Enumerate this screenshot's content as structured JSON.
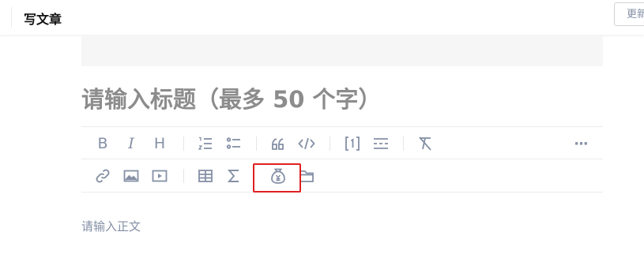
{
  "header": {
    "title": "写文章",
    "update_button": "更新"
  },
  "editor": {
    "title_placeholder": "请输入标题（最多 50 个字）",
    "body_placeholder": "请输入正文"
  },
  "toolbar": {
    "bold": "B",
    "italic": "I",
    "heading": "H",
    "more": "···",
    "icons": [
      "bold-icon",
      "italic-icon",
      "heading-icon",
      "ordered-list-icon",
      "unordered-list-icon",
      "quote-icon",
      "code-icon",
      "reference-icon",
      "divider-icon",
      "clear-format-icon",
      "more-icon",
      "link-icon",
      "image-icon",
      "video-icon",
      "table-icon",
      "formula-icon",
      "money-bag-icon",
      "folder-icon"
    ]
  },
  "colors": {
    "icon": "#8590a6",
    "highlight": "#e02020",
    "cover_bg": "#f6f6f6"
  }
}
